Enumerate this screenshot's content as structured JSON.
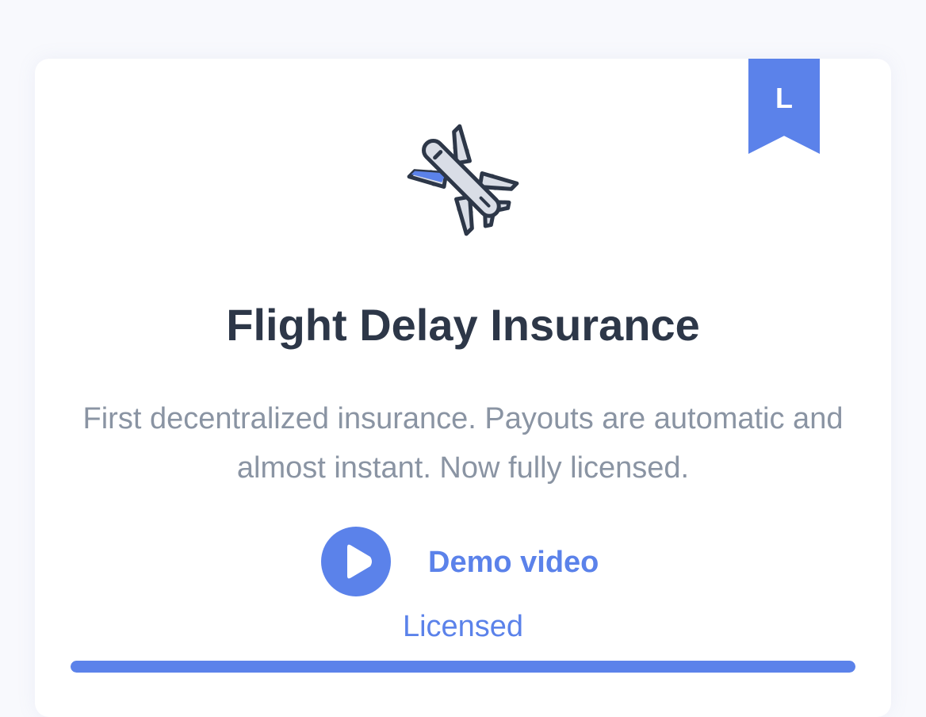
{
  "card": {
    "badge_letter": "L",
    "icon": "airplane-icon",
    "title": "Flight Delay Insurance",
    "description": "First decentralized insurance. Payouts are automatic and almost instant. Now fully licensed.",
    "demo": {
      "icon": "play-icon",
      "label": "Demo video"
    },
    "status_label": "Licensed",
    "progress": 1.0
  },
  "colors": {
    "accent": "#5b82ea",
    "title": "#2d3748",
    "description": "#8a94a3",
    "background": "#f8f9fd",
    "card": "#ffffff"
  }
}
